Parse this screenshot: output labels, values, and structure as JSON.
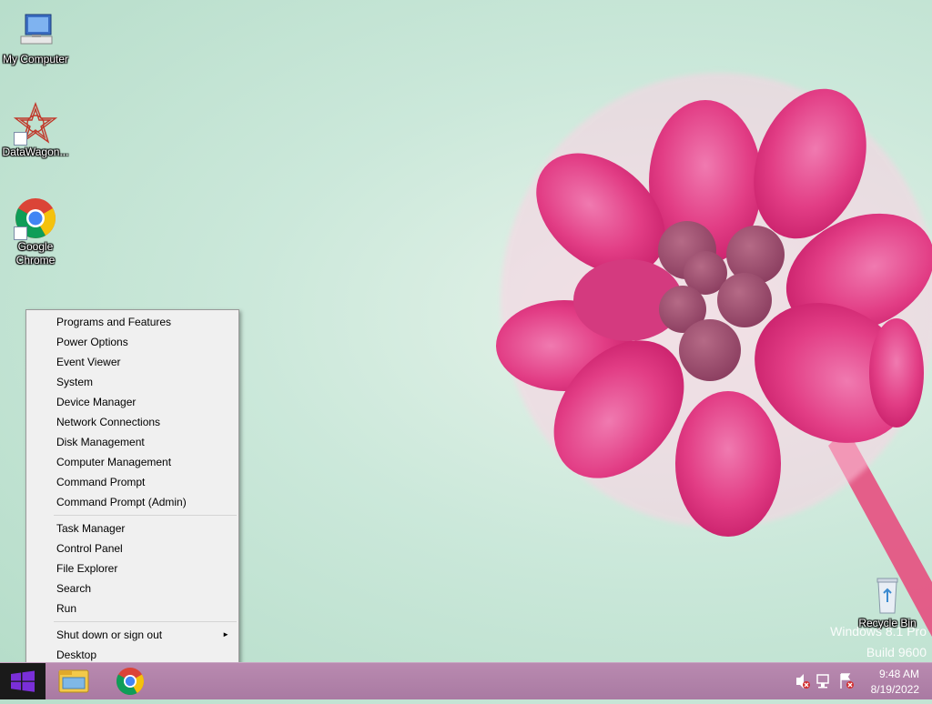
{
  "desktop": {
    "icons": [
      {
        "label": "My Computer"
      },
      {
        "label": "DataWagon..."
      },
      {
        "label": "Google Chrome"
      },
      {
        "label": "Recycle Bin"
      }
    ],
    "watermark": {
      "line1": "Windows 8.1 Pro",
      "line2": "Build 9600"
    }
  },
  "context_menu": {
    "group1": [
      "Programs and Features",
      "Power Options",
      "Event Viewer",
      "System",
      "Device Manager",
      "Network Connections",
      "Disk Management",
      "Computer Management",
      "Command Prompt",
      "Command Prompt (Admin)"
    ],
    "group2": [
      "Task Manager",
      "Control Panel",
      "File Explorer",
      "Search",
      "Run"
    ],
    "group3": [
      "Shut down or sign out",
      "Desktop"
    ],
    "submenu_arrow": "►"
  },
  "taskbar": {
    "pinned": [
      "File Explorer",
      "Google Chrome"
    ],
    "tray_icons": [
      "speaker-muted-icon",
      "network-icon",
      "action-center-flag-icon"
    ],
    "time": "9:48 AM",
    "date": "8/19/2022"
  },
  "colors": {
    "taskbar": "#b085a8",
    "start": "#1a1a1a",
    "accent": "#0078d7"
  }
}
